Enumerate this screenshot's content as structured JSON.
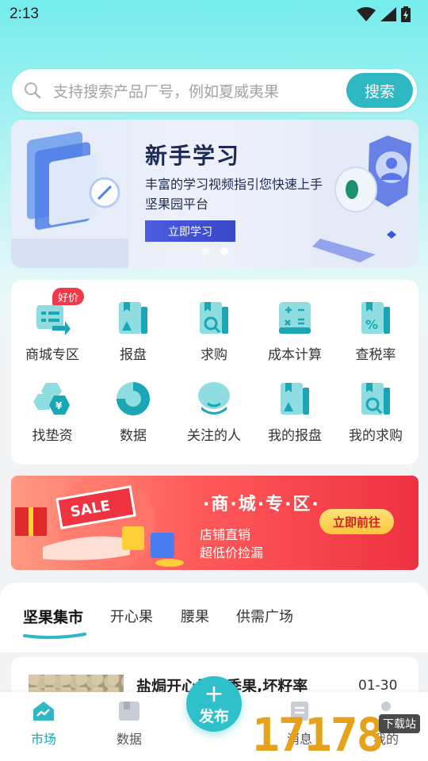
{
  "status": {
    "time": "2:13"
  },
  "search": {
    "placeholder": "支持搜索产品厂号，例如夏威夷果",
    "button": "搜索"
  },
  "banner": {
    "title": "新手学习",
    "line1": "丰富的学习视频指引您快速上手",
    "line2": "坚果园平台",
    "button": "立即学习"
  },
  "grid": {
    "badge": "好价",
    "items": [
      {
        "label": "商城专区",
        "icon": "mall-icon"
      },
      {
        "label": "报盘",
        "icon": "offer-icon"
      },
      {
        "label": "求购",
        "icon": "purchase-search-icon"
      },
      {
        "label": "成本计算",
        "icon": "calculator-icon"
      },
      {
        "label": "查税率",
        "icon": "tax-rate-icon"
      },
      {
        "label": "找垫资",
        "icon": "funding-icon"
      },
      {
        "label": "数据",
        "icon": "pie-chart-icon"
      },
      {
        "label": "关注的人",
        "icon": "follow-icon"
      },
      {
        "label": "我的报盘",
        "icon": "my-offer-icon"
      },
      {
        "label": "我的求购",
        "icon": "my-purchase-icon"
      }
    ]
  },
  "promo": {
    "sale": "SALE",
    "title": "·商·城·专·区·",
    "line1": "店铺直销",
    "line2": "超低价捡漏",
    "button": "立即前往"
  },
  "market": {
    "tabs": [
      "坚果集市",
      "开心果",
      "腰果",
      "供需广场"
    ],
    "active_tab": "坚果集市"
  },
  "product": {
    "title": "盐焗开心果头季果,坏籽率",
    "date": "01-30"
  },
  "nav": {
    "items": [
      "市场",
      "数据",
      "消息",
      "我的"
    ],
    "publish": "发布"
  },
  "watermark": {
    "number": "17178",
    "tag": "下载站"
  },
  "colors": {
    "accent": "#2fb7c4",
    "promo": "#ee3141"
  }
}
